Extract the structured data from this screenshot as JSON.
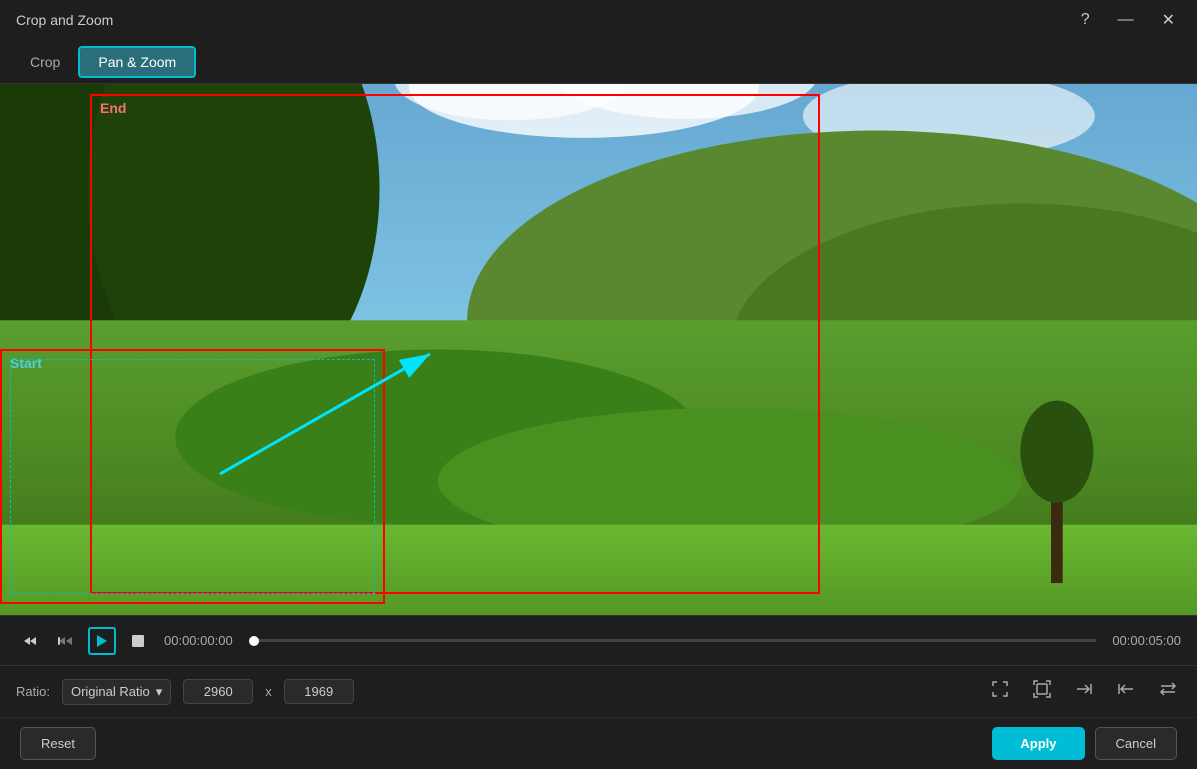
{
  "titleBar": {
    "title": "Crop and Zoom",
    "helpIcon": "?",
    "minimizeIcon": "—",
    "closeIcon": "✕"
  },
  "tabs": {
    "crop": "Crop",
    "panZoom": "Pan & Zoom"
  },
  "canvas": {
    "endLabel": "End",
    "startLabel": "Start"
  },
  "controls": {
    "timeStart": "00:00:00:00",
    "timeEnd": "00:00:05:00"
  },
  "ratio": {
    "label": "Ratio:",
    "selected": "Original Ratio",
    "width": "2960",
    "height": "1969"
  },
  "footer": {
    "resetLabel": "Reset",
    "applyLabel": "Apply",
    "cancelLabel": "Cancel"
  }
}
